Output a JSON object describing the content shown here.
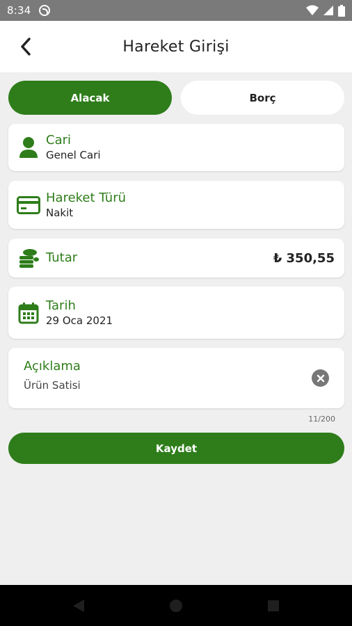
{
  "status": {
    "time": "8:34"
  },
  "appbar": {
    "title": "Hareket Girişi"
  },
  "segment": {
    "credit_label": "Alacak",
    "debit_label": "Borç"
  },
  "cards": {
    "account": {
      "label": "Cari",
      "value": "Genel Cari",
      "icon": "person-icon"
    },
    "movement_type": {
      "label": "Hareket Türü",
      "value": "Nakit",
      "icon": "credit-card-icon"
    },
    "amount": {
      "label": "Tutar",
      "value": "₺ 350,55",
      "icon": "coins-icon"
    },
    "date": {
      "label": "Tarih",
      "value": "29 Oca 2021",
      "icon": "calendar-icon"
    }
  },
  "description": {
    "label": "Açıklama",
    "value": "Ürün Satisi",
    "counter": "11/200"
  },
  "save_label": "Kaydet",
  "colors": {
    "accent": "#2e7d1a",
    "statusbar": "#7a7a7a",
    "background": "#efefef"
  }
}
